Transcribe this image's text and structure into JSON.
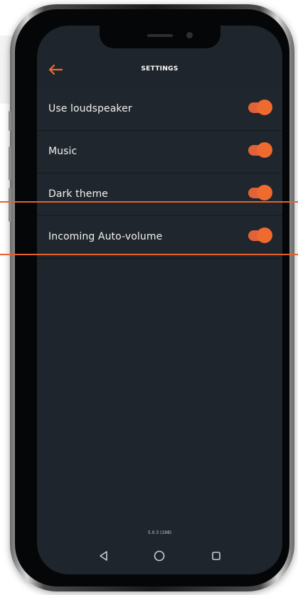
{
  "header": {
    "title": "SETTINGS",
    "back_icon": "arrow-left-icon"
  },
  "settings": [
    {
      "label": "Use loudspeaker",
      "enabled": true
    },
    {
      "label": "Music",
      "enabled": true
    },
    {
      "label": "Dark theme",
      "enabled": true
    },
    {
      "label": "Incoming Auto-volume",
      "enabled": true
    }
  ],
  "footer": {
    "version": "5.0.3 (198)"
  },
  "navbar": {
    "back_icon": "triangle-back-icon",
    "home_icon": "circle-home-icon",
    "recents_icon": "square-recents-icon"
  },
  "colors": {
    "screen_background": "#1e252c",
    "accent": "#ef6a2f",
    "text": "#f2f2f2",
    "highlight_line": "#e5622e"
  }
}
